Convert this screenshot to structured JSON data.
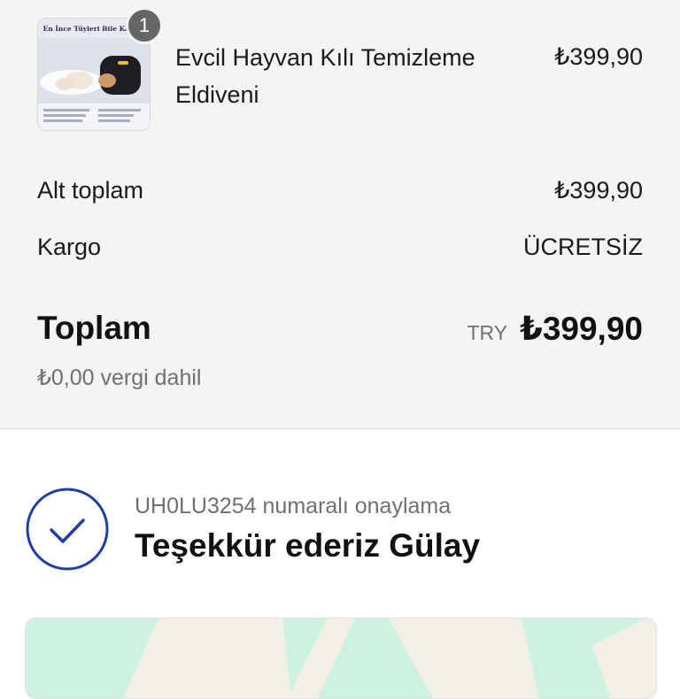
{
  "order_summary": {
    "item": {
      "quantity": "1",
      "name": "Evcil Hayvan Kılı Temizleme Eldiveni",
      "price": "₺399,90",
      "image_caption": "En İnce Tüyleri Bile Kaçır"
    },
    "subtotal": {
      "label": "Alt toplam",
      "value": "₺399,90"
    },
    "shipping": {
      "label": "Kargo",
      "value": "ÜCRETSİZ"
    },
    "total": {
      "label": "Toplam",
      "currency": "TRY",
      "value": "₺399,90"
    },
    "tax_note": "₺0,00 vergi dahil"
  },
  "confirmation": {
    "number_text": "UH0LU3254 numaralı onaylama",
    "thanks_text": "Teşekkür ederiz Gülay",
    "icon": "check-circle-icon"
  },
  "map": {
    "colors": {
      "land": "#f2efe6",
      "park": "#cdf2df"
    }
  },
  "colors": {
    "summary_bg": "#f4f4f4",
    "accent": "#1f3fa8",
    "muted_text": "#707070",
    "badge": "#666666"
  }
}
